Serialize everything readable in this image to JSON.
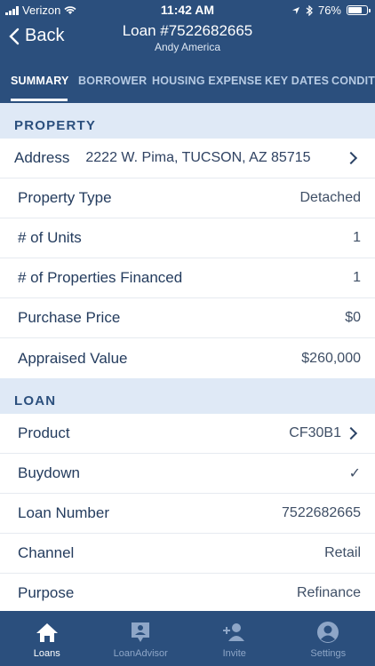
{
  "status_bar": {
    "carrier": "Verizon",
    "time": "11:42 AM",
    "battery": "76%",
    "battery_level": 0.76
  },
  "nav": {
    "back_label": "Back",
    "title": "Loan #7522682665",
    "subtitle": "Andy America"
  },
  "tabs": [
    "SUMMARY",
    "BORROWER",
    "HOUSING EXPENSE",
    "KEY DATES",
    "CONDIT"
  ],
  "property": {
    "header": "PROPERTY",
    "address_label": "Address",
    "address_value": "2222 W. Pima, TUCSON, AZ 85715",
    "rows": [
      {
        "label": "Property Type",
        "value": "Detached"
      },
      {
        "label": "# of Units",
        "value": "1"
      },
      {
        "label": "# of Properties Financed",
        "value": "1"
      },
      {
        "label": "Purchase Price",
        "value": "$0"
      },
      {
        "label": "Appraised Value",
        "value": "$260,000"
      }
    ]
  },
  "loan": {
    "header": "LOAN",
    "product_label": "Product",
    "product_value": "CF30B1",
    "buydown_label": "Buydown",
    "buydown_value": "✓",
    "rows": [
      {
        "label": "Loan Number",
        "value": "7522682665"
      },
      {
        "label": "Channel",
        "value": "Retail"
      },
      {
        "label": "Purpose",
        "value": "Refinance"
      }
    ]
  },
  "tabbar": [
    "Loans",
    "LoanAdvisor",
    "Invite",
    "Settings"
  ],
  "colors": {
    "primary": "#2b4f7d",
    "section_bg": "#dfe9f6"
  }
}
